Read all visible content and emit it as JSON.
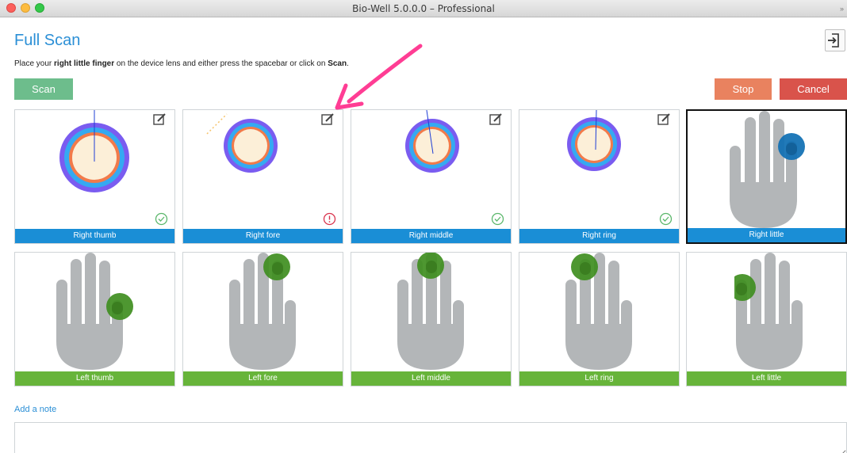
{
  "window": {
    "title": "Bio-Well 5.0.0.0 – Professional",
    "scroll_glyph": "»"
  },
  "header": {
    "title": "Full Scan",
    "export_icon": "export-icon"
  },
  "instruction": {
    "prefix": "Place your ",
    "finger": "right little finger",
    "middle": " on the device lens and either press the spacebar or click on ",
    "action": "Scan",
    "suffix": "."
  },
  "buttons": {
    "scan": "Scan",
    "stop": "Stop",
    "cancel": "Cancel"
  },
  "right_hand": [
    {
      "label": "Right thumb",
      "state": "scanned",
      "status": "ok"
    },
    {
      "label": "Right fore",
      "state": "scanned",
      "status": "warning"
    },
    {
      "label": "Right middle",
      "state": "scanned",
      "status": "ok"
    },
    {
      "label": "Right ring",
      "state": "scanned",
      "status": "ok"
    },
    {
      "label": "Right little",
      "state": "current"
    }
  ],
  "left_hand": [
    {
      "label": "Left thumb",
      "state": "pending"
    },
    {
      "label": "Left fore",
      "state": "pending"
    },
    {
      "label": "Left middle",
      "state": "pending"
    },
    {
      "label": "Left ring",
      "state": "pending"
    },
    {
      "label": "Left little",
      "state": "pending"
    }
  ],
  "note": {
    "link": "Add a note",
    "value": ""
  },
  "colors": {
    "accent_blue": "#2b8fd6",
    "right_label": "#1a8ed6",
    "left_label": "#67b43a",
    "scan_button": "#6dbd8c",
    "stop_button": "#e9825f",
    "cancel_button": "#d9534b",
    "ok_status": "#5bb76b",
    "warning_status": "#d9334d",
    "annotation_arrow": "#ff3d94"
  }
}
